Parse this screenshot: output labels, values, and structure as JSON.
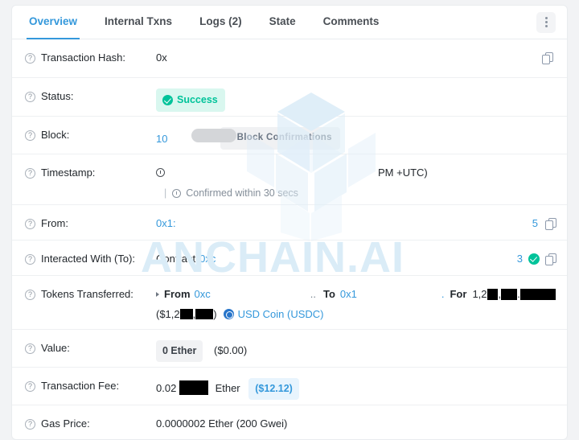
{
  "tabs": [
    {
      "label": "Overview",
      "active": true
    },
    {
      "label": "Internal Txns",
      "active": false
    },
    {
      "label": "Logs (2)",
      "active": false
    },
    {
      "label": "State",
      "active": false
    },
    {
      "label": "Comments",
      "active": false
    }
  ],
  "menu": {
    "icon": "kebab-menu-icon"
  },
  "watermark": {
    "text": "ANCHAIN.AI",
    "logo": "anchain-cube-logo",
    "color": "#daecf7"
  },
  "colors": {
    "accent_blue": "#3498db",
    "success_green": "#00c39a",
    "success_bg": "#d9f7ef",
    "chip_blue_bg": "#e8f4fd",
    "chip_grey_bg": "#f1f2f4",
    "usdc_blue": "#2775ca"
  },
  "rows": {
    "transaction_hash": {
      "label": "Transaction Hash:",
      "value": "0x",
      "copy_icon": "copy-icon"
    },
    "status": {
      "label": "Status:",
      "badge": "Success",
      "badge_icon": "check-circle-icon"
    },
    "block": {
      "label": "Block:",
      "value": "10",
      "confirmations": "9 Block Confirmations"
    },
    "timestamp": {
      "label": "Timestamp:",
      "clock_icon": "clock-icon",
      "value": "",
      "value_suffix": "PM +UTC)",
      "separator": "|",
      "confirmed_icon": "stopwatch-icon",
      "confirmed": "Confirmed within 30 secs"
    },
    "from": {
      "label": "From:",
      "address": "0x1:",
      "address_tail": "5",
      "copy_icon": "copy-icon"
    },
    "interacted_with": {
      "label": "Interacted With (To):",
      "prefix": "Contract",
      "address": "0xc",
      "address_tail": "3",
      "verified_icon": "check-circle-icon",
      "copy_icon": "copy-icon"
    },
    "tokens_transferred": {
      "label": "Tokens Transferred:",
      "caret_icon": "caret-right-icon",
      "from_label": "From",
      "from_address": "0xc",
      "ellipsis": "..",
      "to_label": "To",
      "to_address": "0x1",
      "period": ".",
      "for_label": "For",
      "amount_prefix": "1,2",
      "amount_sep1": ",",
      "amount_sep2": ".",
      "usd_open": "($1,2",
      "usd_sep": ",",
      "usd_close": ")",
      "token_icon": "usdc-token-icon",
      "token_name": "USD Coin (USDC)"
    },
    "value": {
      "label": "Value:",
      "chip": "0 Ether",
      "usd": "($0.00)"
    },
    "transaction_fee": {
      "label": "Transaction Fee:",
      "amount_prefix": "0.02",
      "unit": "Ether",
      "usd_chip": "($12.12)"
    },
    "gas_price": {
      "label": "Gas Price:",
      "value": "0.0000002 Ether (200 Gwei)"
    }
  },
  "help_icon": "question-mark-icon"
}
